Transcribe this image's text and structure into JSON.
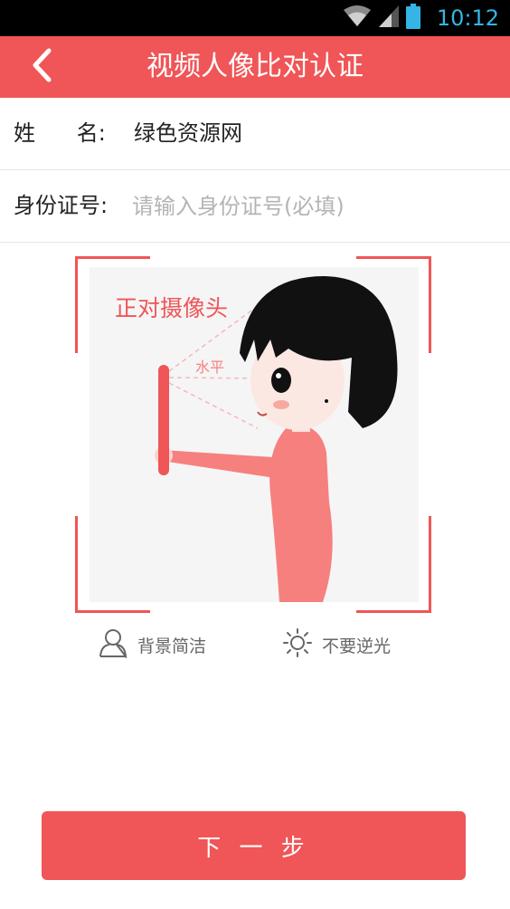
{
  "status_bar": {
    "time": "10:12",
    "icons": [
      "wifi-icon",
      "signal-icon",
      "battery-icon"
    ],
    "clock_color": "#35b5e5"
  },
  "app_bar": {
    "title": "视频人像比对认证",
    "back_icon": "chevron-left-icon",
    "background": "#f05557"
  },
  "form": {
    "name_label": "姓      名:",
    "name_value": "绿色资源网",
    "id_label": "身份证号:",
    "id_value": "",
    "id_placeholder": "请输入身份证号(必填)"
  },
  "illustration": {
    "caption": "正对摄像头",
    "level_label": "水平",
    "accent": "#f05557"
  },
  "tips": [
    {
      "icon": "person-outline-icon",
      "label": "背景简洁"
    },
    {
      "icon": "sun-icon",
      "label": "不要逆光"
    }
  ],
  "next_button": {
    "label": "下 一 步"
  }
}
